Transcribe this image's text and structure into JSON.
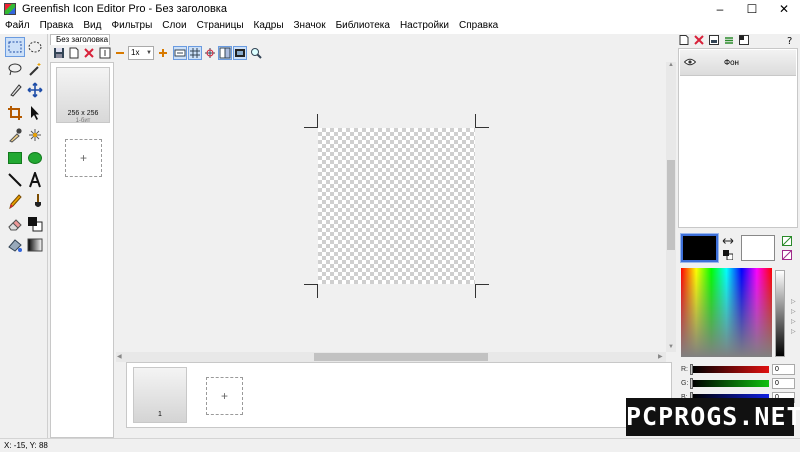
{
  "window": {
    "title": "Greenfish Icon Editor Pro - Без заголовка",
    "minimize": "–",
    "maximize": "☐",
    "close": "✕"
  },
  "menu": [
    "Файл",
    "Правка",
    "Вид",
    "Фильтры",
    "Слои",
    "Страницы",
    "Кадры",
    "Значок",
    "Библиотека",
    "Настройки",
    "Справка"
  ],
  "document": {
    "tab": "Без заголовка",
    "zoom": "1x"
  },
  "formats": [
    {
      "size": "256 x 256",
      "bits": "1-бит"
    }
  ],
  "add_symbol": "+",
  "frames": [
    {
      "number": "1"
    }
  ],
  "layers": [
    {
      "name": "Фон",
      "visible": true
    }
  ],
  "colors": {
    "primary": "#000000",
    "secondary": "#ffffff",
    "accent": "#3d6fd8"
  },
  "rgb": [
    {
      "label": "R:",
      "value": "0",
      "color": "#e01010"
    },
    {
      "label": "G:",
      "value": "0",
      "color": "#10c010"
    },
    {
      "label": "B:",
      "value": "0",
      "color": "#1020e0"
    }
  ],
  "status": {
    "coords": "X: -15, Y: 88"
  },
  "watermark": "PCPROGS.NET"
}
